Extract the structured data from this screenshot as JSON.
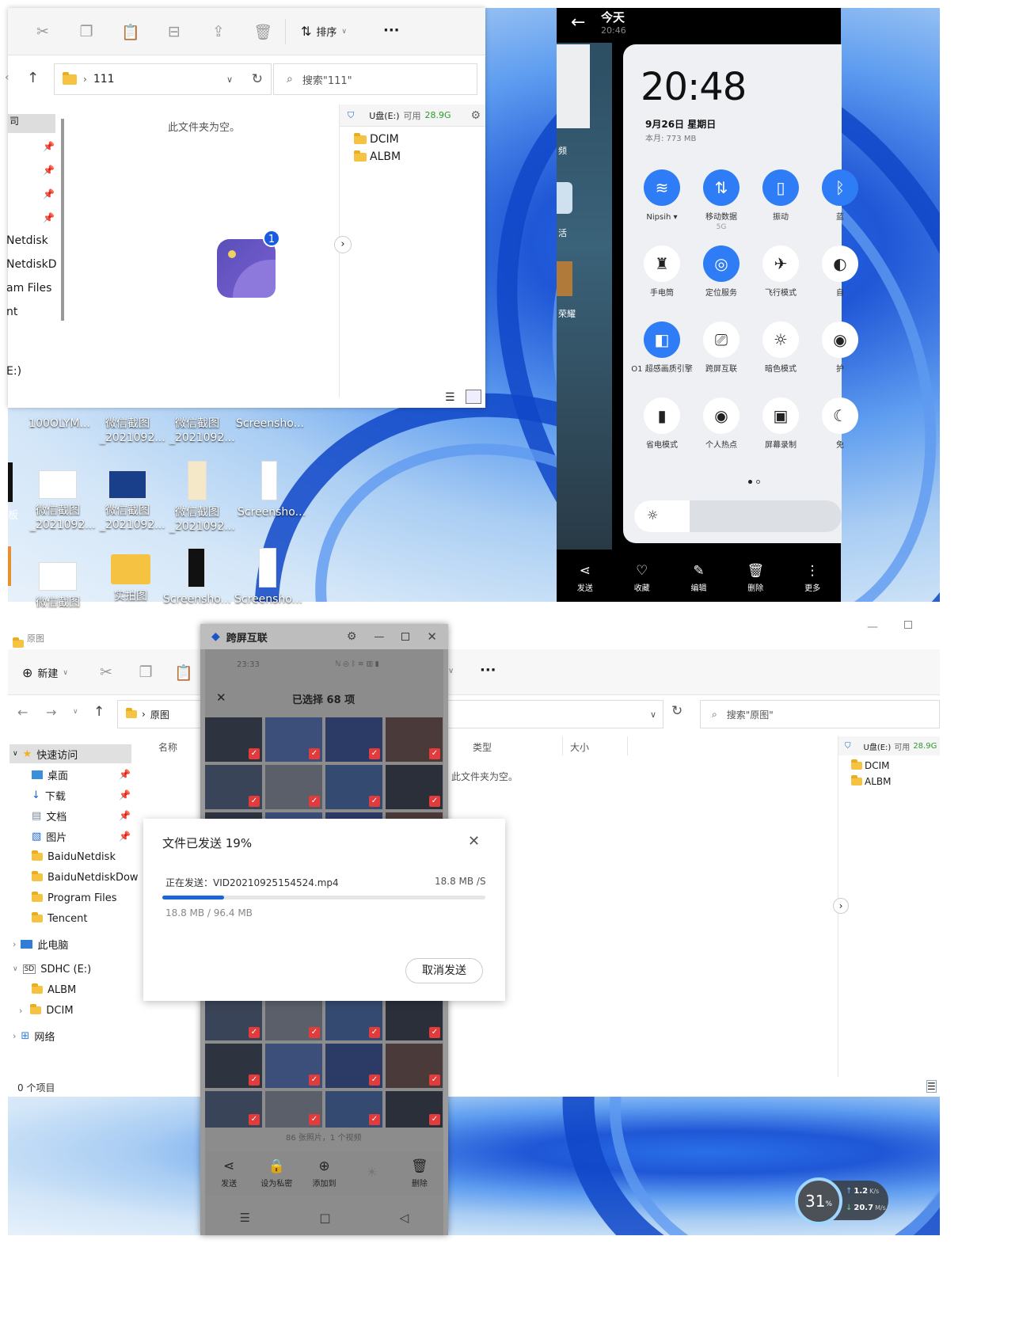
{
  "top": {
    "explorer": {
      "toolbar": {
        "sort_label": "排序",
        "more": "···"
      },
      "address": {
        "path": "111",
        "search_placeholder": "搜索\"111\""
      },
      "empty_text": "此文件夹为空。",
      "sidebar_items": [
        "Netdisk",
        "NetdiskD",
        "am Files",
        "nt",
        "E:)"
      ],
      "usb": {
        "drive": "U盘(E:)",
        "avail_label": "可用",
        "avail": "28.9G",
        "folders": [
          "DCIM",
          "ALBM"
        ]
      },
      "badge_count": "1"
    },
    "desktop": {
      "row1": [
        "100OLYM...",
        "微信截图\n_2021092...",
        "微信截图\n_2021092...",
        "Screensho..."
      ],
      "row2": [
        "微信截图\n_2021092...",
        "微信截图\n_2021092...",
        "微信截图\n_2021092...",
        "Screensho..."
      ],
      "row3": [
        "微信截图",
        "实拍图",
        "Screensho...",
        "Screensho..."
      ],
      "left_text": "板"
    },
    "phone": {
      "header_title": "今天",
      "header_time": "20:46",
      "side_labels": [
        "频",
        "活",
        "荣耀"
      ],
      "clock": "20:48",
      "date": "9月26日  星期日",
      "usage": "本月: 773 MB",
      "tiles": [
        {
          "label": "Nipsih ▾",
          "sub": "",
          "on": true,
          "icon": "wifi-icon",
          "glyph": "≋"
        },
        {
          "label": "移动数据",
          "sub": "5G",
          "on": true,
          "icon": "mobile-data-icon",
          "glyph": "⇅"
        },
        {
          "label": "振动",
          "sub": "",
          "on": true,
          "icon": "vibrate-icon",
          "glyph": "▯"
        },
        {
          "label": "蓝",
          "sub": "",
          "on": true,
          "icon": "bluetooth-icon",
          "glyph": "ᛒ"
        },
        {
          "label": "手电筒",
          "sub": "",
          "on": false,
          "icon": "flashlight-icon",
          "glyph": "♜"
        },
        {
          "label": "定位服务",
          "sub": "",
          "on": true,
          "icon": "location-icon",
          "glyph": "◎"
        },
        {
          "label": "飞行模式",
          "sub": "",
          "on": false,
          "icon": "airplane-icon",
          "glyph": "✈"
        },
        {
          "label": "自",
          "sub": "",
          "on": false,
          "icon": "auto-icon",
          "glyph": "◐"
        },
        {
          "label": "O1 超感画质引擎",
          "sub": "",
          "on": true,
          "icon": "display-engine-icon",
          "glyph": "◧"
        },
        {
          "label": "跨屏互联",
          "sub": "",
          "on": false,
          "icon": "cross-screen-icon",
          "glyph": "⎚"
        },
        {
          "label": "暗色模式",
          "sub": "",
          "on": false,
          "icon": "dark-mode-icon",
          "glyph": "☼"
        },
        {
          "label": "护",
          "sub": "",
          "on": false,
          "icon": "eye-care-icon",
          "glyph": "◉"
        },
        {
          "label": "省电模式",
          "sub": "",
          "on": false,
          "icon": "battery-saver-icon",
          "glyph": "▮"
        },
        {
          "label": "个人热点",
          "sub": "",
          "on": false,
          "icon": "hotspot-icon",
          "glyph": "◉"
        },
        {
          "label": "屏幕录制",
          "sub": "",
          "on": false,
          "icon": "screen-record-icon",
          "glyph": "▣"
        },
        {
          "label": "免",
          "sub": "",
          "on": false,
          "icon": "dnd-icon",
          "glyph": "☾"
        }
      ],
      "bottom_tools": [
        {
          "label": "发送",
          "icon": "share-icon",
          "glyph": "⋖"
        },
        {
          "label": "收藏",
          "icon": "heart-icon",
          "glyph": "♡"
        },
        {
          "label": "编辑",
          "icon": "edit-icon",
          "glyph": "✎"
        },
        {
          "label": "删除",
          "icon": "trash-icon",
          "glyph": "🗑"
        },
        {
          "label": "更多",
          "icon": "more-vertical-icon",
          "glyph": "⋮"
        }
      ]
    }
  },
  "bottom": {
    "explorer": {
      "title": "原图",
      "new_label": "新建",
      "path": "原图",
      "search_placeholder": "搜索\"原图\"",
      "columns": [
        "名称",
        "类型",
        "大小"
      ],
      "empty_text": "此文件夹为空。",
      "status": "0 个项目",
      "usb": {
        "drive": "U盘(E:)",
        "avail_label": "可用",
        "avail": "28.9G",
        "folders": [
          "DCIM",
          "ALBM"
        ]
      },
      "sidebar": {
        "quick_access": "快速访问",
        "pinned": [
          "桌面",
          "下载",
          "文档",
          "图片"
        ],
        "folders": [
          "BaiduNetdisk",
          "BaiduNetdiskDow",
          "Program Files",
          "Tencent"
        ],
        "this_pc": "此电脑",
        "sdhc": "SDHC (E:)",
        "sdhc_children": [
          "ALBM",
          "DCIM"
        ],
        "network": "网络"
      }
    },
    "mirror": {
      "title": "跨屏互联",
      "status_time": "23:33",
      "selected": "已选择 68 项",
      "footer_count": "86 张照片，1 个视频",
      "tools": [
        "发送",
        "设为私密",
        "添加到",
        "",
        "删除"
      ]
    },
    "dialog": {
      "title": "文件已发送 19%",
      "sending_label": "正在发送：VID20210925154524.mp4",
      "speed": "18.8 MB /S",
      "progress_pct": 19,
      "size_text": "18.8 MB / 96.4 MB",
      "cancel_label": "取消发送"
    },
    "widget": {
      "cpu": "31",
      "unit": "%",
      "up": "1.2",
      "up_unit": "K/s",
      "down": "20.7",
      "down_unit": "M/s"
    }
  },
  "colors": {
    "accent": "#2f7df6",
    "progress": "#1a66d6",
    "usb_green": "#2b9b2b"
  }
}
